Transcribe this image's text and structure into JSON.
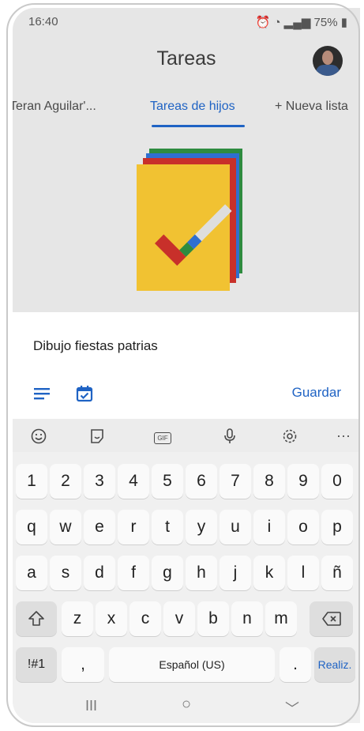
{
  "status_bar": {
    "time": "16:40",
    "right_text": "75%"
  },
  "app": {
    "title": "Tareas",
    "tabs": [
      {
        "label": "Teran Aguilar'..."
      },
      {
        "label": "Tareas de hijos"
      },
      {
        "label": "+  Nueva lista"
      }
    ]
  },
  "sheet": {
    "task_text": "Dibujo fiestas patrias",
    "save_label": "Guardar",
    "details_icon": "details-lines-icon",
    "date_icon": "calendar-check-icon"
  },
  "keyboard": {
    "toolbar_icons": [
      "emoji-icon",
      "sticker-icon",
      "gif-icon",
      "microphone-icon",
      "settings-icon",
      "more-icon"
    ],
    "gif_label": "GIF",
    "more_label": "···",
    "number_row": [
      "1",
      "2",
      "3",
      "4",
      "5",
      "6",
      "7",
      "8",
      "9",
      "0"
    ],
    "row1": [
      "q",
      "w",
      "e",
      "r",
      "t",
      "y",
      "u",
      "i",
      "o",
      "p"
    ],
    "row2": [
      "a",
      "s",
      "d",
      "f",
      "g",
      "h",
      "j",
      "k",
      "l",
      "ñ"
    ],
    "row3": [
      "z",
      "x",
      "c",
      "v",
      "b",
      "n",
      "m"
    ],
    "shift_icon": "shift-icon",
    "backspace_icon": "backspace-icon",
    "symbols_label": "!#1",
    "comma_label": ",",
    "space_label": "Español (US)",
    "period_label": ".",
    "action_label": "Realiz."
  },
  "nav_bar": {
    "recents_label": "III",
    "home_label": "○",
    "back_label": "﹀"
  },
  "colors": {
    "accent": "#1f63c4",
    "dim_background": "#e6e6e6"
  }
}
